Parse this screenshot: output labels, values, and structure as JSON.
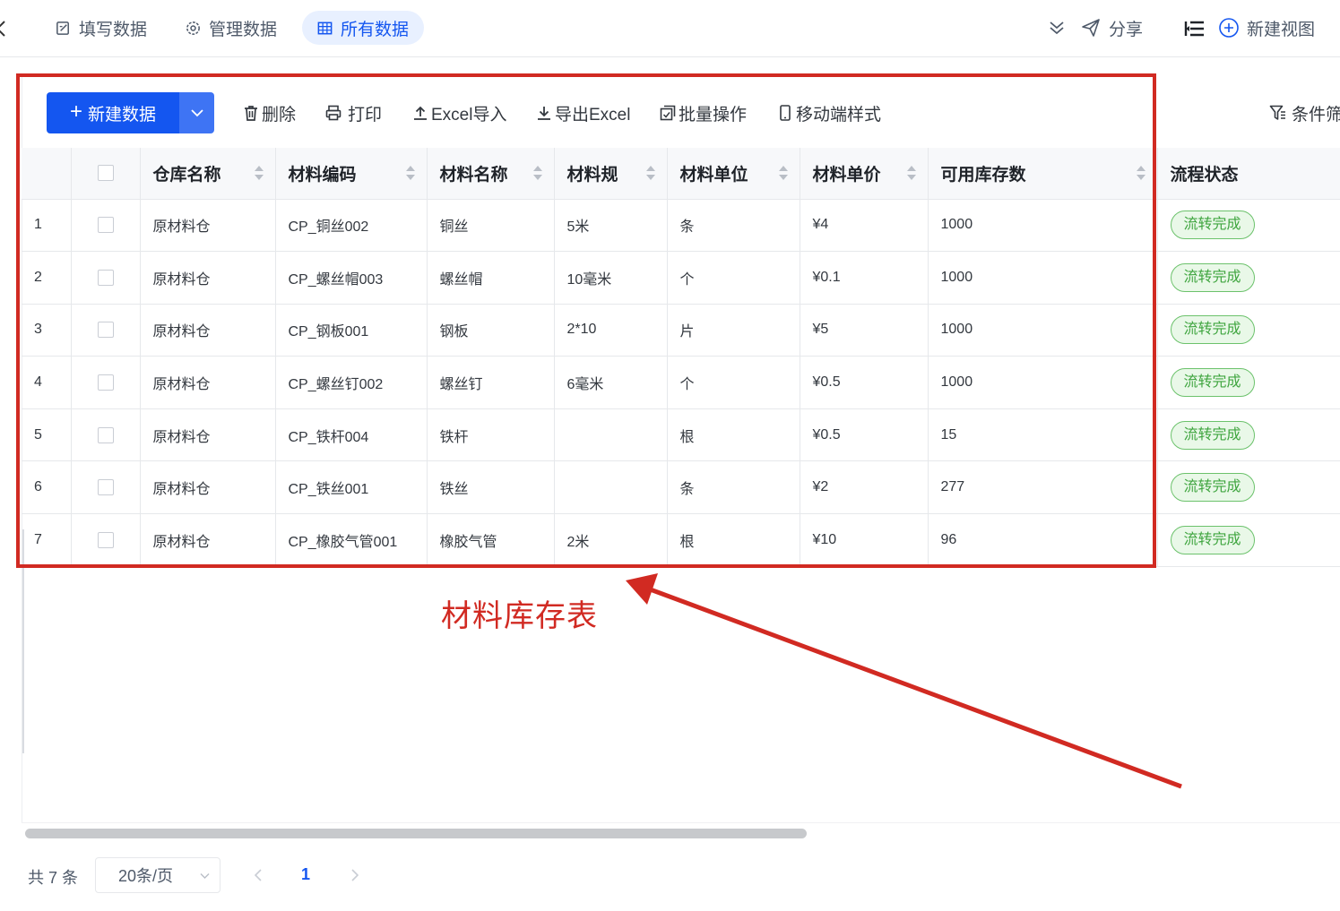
{
  "nav": {
    "tabs": [
      {
        "label": "填写数据",
        "icon": "edit-form-icon"
      },
      {
        "label": "管理数据",
        "icon": "gear-icon"
      },
      {
        "label": "所有数据",
        "icon": "table-icon",
        "active": true
      }
    ],
    "share_label": "分享",
    "new_view_label": "新建视图"
  },
  "toolbar": {
    "new_label": "新建数据",
    "delete_label": "删除",
    "print_label": "打印",
    "import_label": "Excel导入",
    "export_label": "导出Excel",
    "batch_label": "批量操作",
    "mobile_label": "移动端样式",
    "filter_label": "条件筛"
  },
  "table": {
    "columns": [
      "仓库名称",
      "材料编码",
      "材料名称",
      "材料规",
      "材料单位",
      "材料单价",
      "可用库存数",
      "流程状态"
    ],
    "rows": [
      {
        "index": "1",
        "warehouse": "原材料仓",
        "code": "CP_铜丝002",
        "name": "铜丝",
        "spec": "5米",
        "unit": "条",
        "price": "¥4",
        "stock": "1000",
        "status": "流转完成"
      },
      {
        "index": "2",
        "warehouse": "原材料仓",
        "code": "CP_螺丝帽003",
        "name": "螺丝帽",
        "spec": "10毫米",
        "unit": "个",
        "price": "¥0.1",
        "stock": "1000",
        "status": "流转完成"
      },
      {
        "index": "3",
        "warehouse": "原材料仓",
        "code": "CP_钢板001",
        "name": "钢板",
        "spec": "2*10",
        "unit": "片",
        "price": "¥5",
        "stock": "1000",
        "status": "流转完成"
      },
      {
        "index": "4",
        "warehouse": "原材料仓",
        "code": "CP_螺丝钉002",
        "name": "螺丝钉",
        "spec": "6毫米",
        "unit": "个",
        "price": "¥0.5",
        "stock": "1000",
        "status": "流转完成"
      },
      {
        "index": "5",
        "warehouse": "原材料仓",
        "code": "CP_铁杆004",
        "name": "铁杆",
        "spec": "",
        "unit": "根",
        "price": "¥0.5",
        "stock": "15",
        "status": "流转完成"
      },
      {
        "index": "6",
        "warehouse": "原材料仓",
        "code": "CP_铁丝001",
        "name": "铁丝",
        "spec": "",
        "unit": "条",
        "price": "¥2",
        "stock": "277",
        "status": "流转完成"
      },
      {
        "index": "7",
        "warehouse": "原材料仓",
        "code": "CP_橡胶气管001",
        "name": "橡胶气管",
        "spec": "2米",
        "unit": "根",
        "price": "¥10",
        "stock": "96",
        "status": "流转完成"
      }
    ]
  },
  "annotation": {
    "label": "材料库存表",
    "color": "#d12a22"
  },
  "pagination": {
    "total_label": "共 7 条",
    "page_size": "20条/页",
    "current_page": "1"
  },
  "colors": {
    "accent": "#1456f0",
    "status_green": "#3fa53f",
    "status_bg": "#e9f8e8"
  }
}
